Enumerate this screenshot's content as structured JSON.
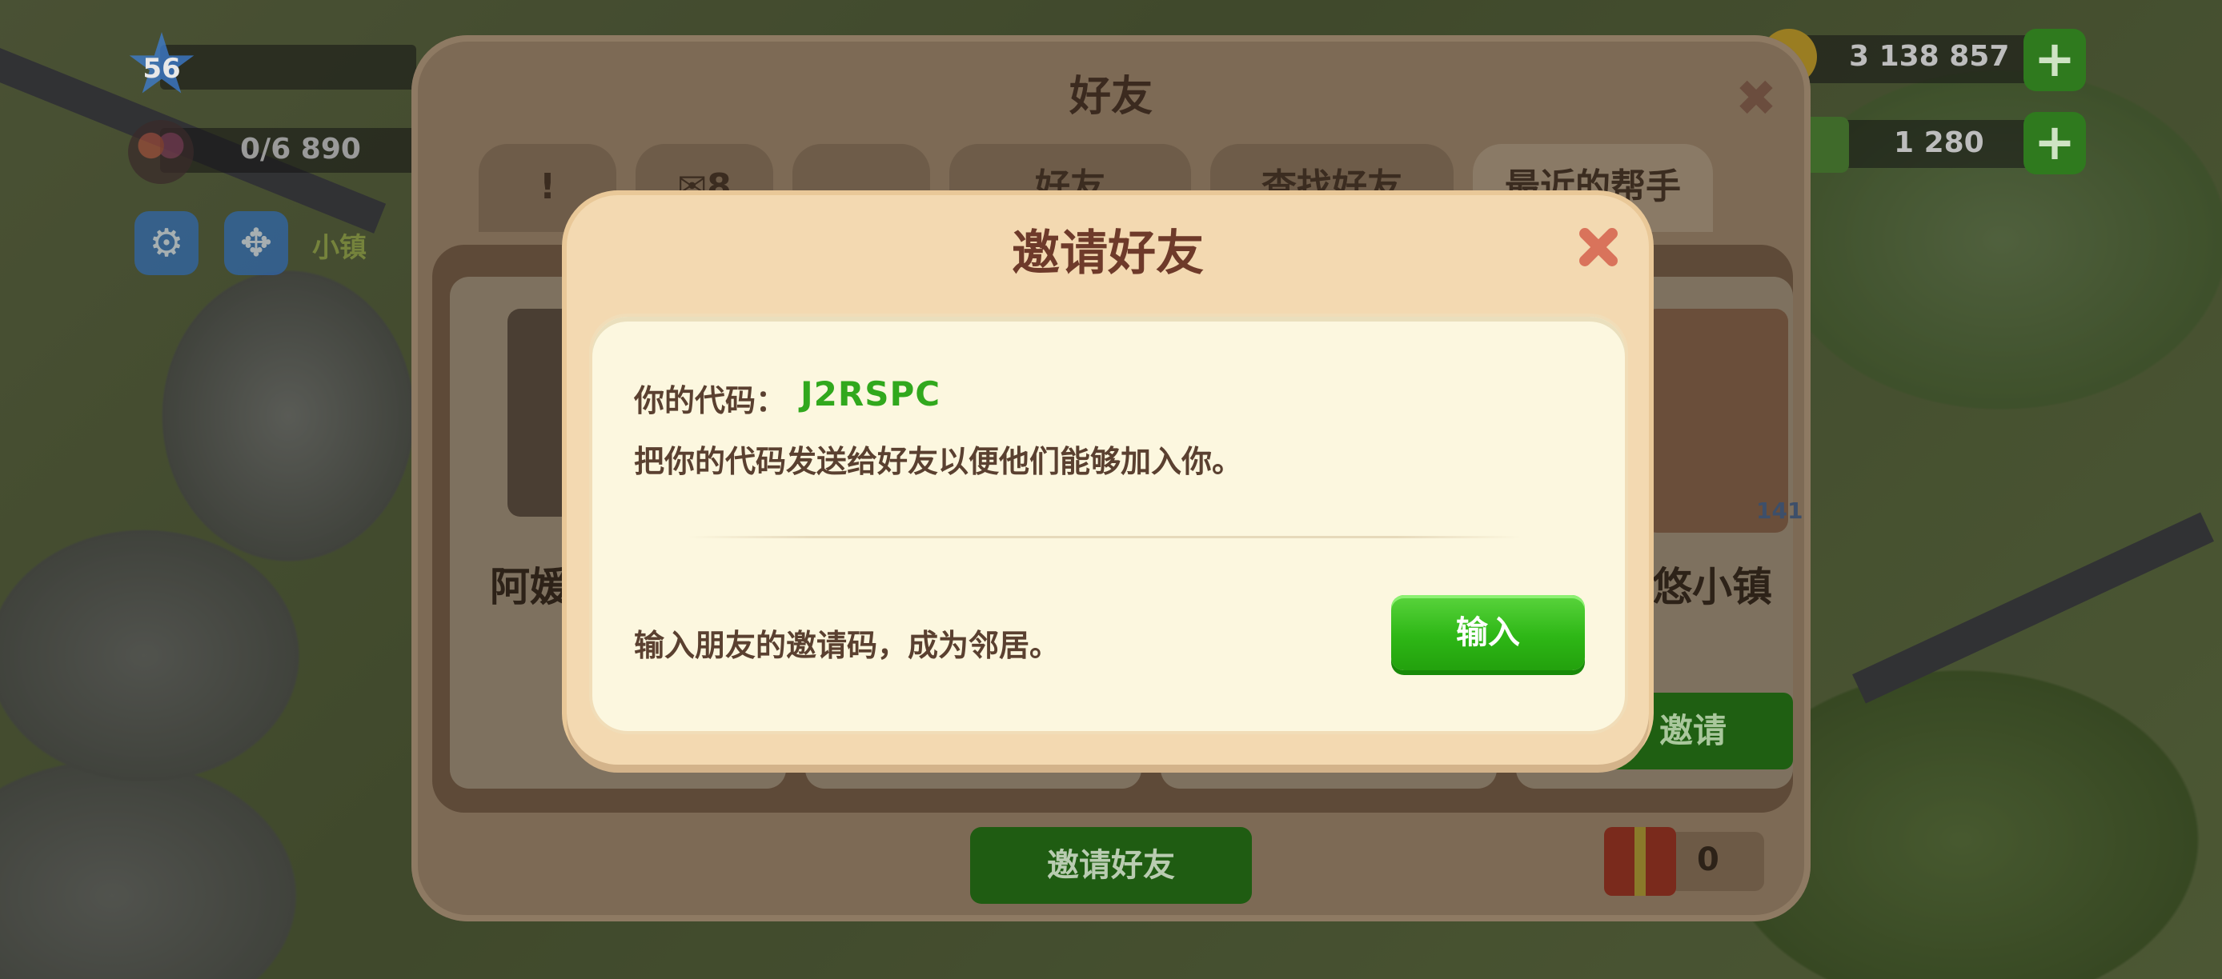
{
  "hud": {
    "level": "56",
    "population": "0/6 890",
    "coins": "3 138 857",
    "cash": "1 280",
    "plus_label": "+",
    "town_label": "小镇"
  },
  "friends_panel": {
    "title": "好友",
    "tabs": [
      "!",
      "✉8",
      "",
      "好友",
      "查找好友",
      "最近的帮手"
    ],
    "cards": [
      {
        "name": "阿媛",
        "button": ""
      },
      {
        "name": "",
        "button": ""
      },
      {
        "name": "",
        "button": ""
      },
      {
        "name": "悠小镇",
        "button": "邀请",
        "badge": "141"
      }
    ],
    "invite_button": "邀请好友",
    "gift_count": "0"
  },
  "invite_dialog": {
    "title": "邀请好友",
    "code_label": "你的代码：",
    "code_value": "J2RSPC",
    "code_description": "把你的代码发送给好友以便他们能够加入你。",
    "enter_description": "输入朋友的邀请码，成为邻居。",
    "enter_button": "输入"
  },
  "colors": {
    "code_green": "#31a81d",
    "button_green": "#2eb716",
    "dialog_bg": "#f3d9b1",
    "close_x": "#d9735b"
  },
  "icons": [
    "star-icon",
    "friends-icon",
    "gear-icon",
    "move-icon",
    "coin-icon",
    "cash-icon",
    "plus-icon",
    "close-icon",
    "alert-icon",
    "mail-icon",
    "gift-icon"
  ]
}
